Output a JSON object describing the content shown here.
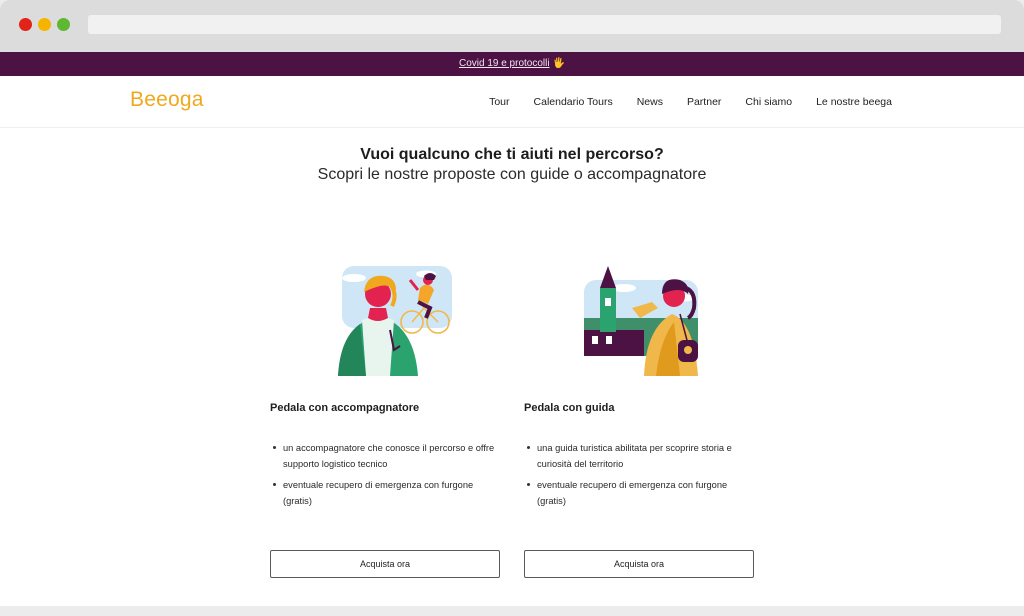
{
  "promo": {
    "link_text": "Covid 19 e protocolli",
    "emoji": "🖐"
  },
  "brand": {
    "logo_text": "Beeoga",
    "accent_color": "#f0a81e",
    "promo_bg": "#4b1243"
  },
  "nav": [
    {
      "label": "Tour"
    },
    {
      "label": "Calendario Tours"
    },
    {
      "label": "News"
    },
    {
      "label": "Partner"
    },
    {
      "label": "Chi siamo"
    },
    {
      "label": "Le nostre beega"
    }
  ],
  "hero": {
    "title": "Vuoi qualcuno che ti aiuti nel percorso?",
    "subtitle": "Scopri le nostre proposte con guide o accompagnatore"
  },
  "cards": [
    {
      "title": "Pedala con accompagnatore",
      "bullets": [
        "un accompagnatore che conosce il percorso e offre supporto logistico tecnico",
        "eventuale recupero di emergenza con furgone (gratis)"
      ],
      "button_label": "Acquista ora"
    },
    {
      "title": "Pedala con guida",
      "bullets": [
        "una guida turistica abilitata per scoprire storia e curiosità del territorio",
        "eventuale recupero di emergenza con furgone (gratis)"
      ],
      "button_label": "Acquista ora"
    }
  ]
}
